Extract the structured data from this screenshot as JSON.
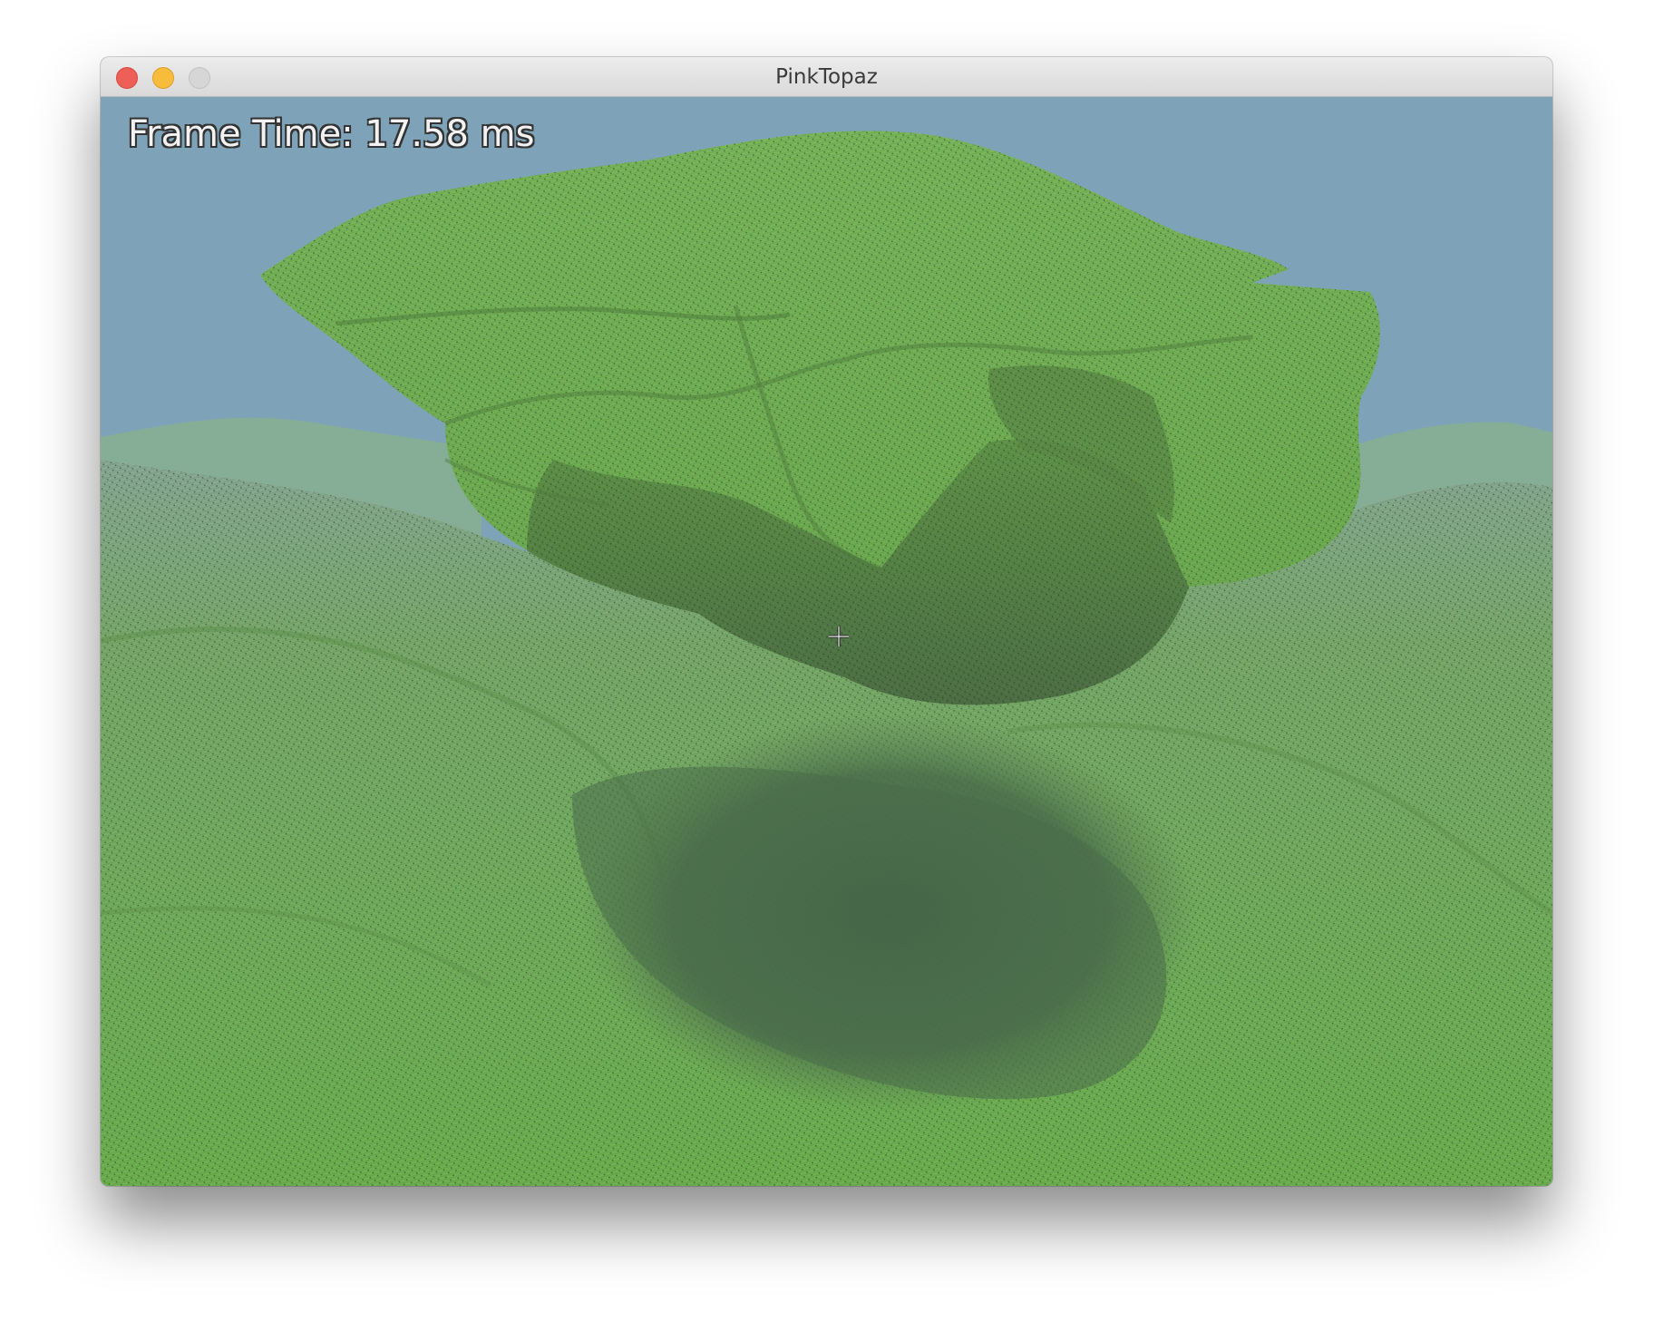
{
  "window": {
    "title": "PinkTopaz"
  },
  "hud": {
    "frame_time_label": "Frame Time: 17.58 ms"
  },
  "scene": {
    "sky_color": "#7ea3b8",
    "terrain_color": "#6fae55",
    "shadow_color": "#4a6b4a"
  }
}
